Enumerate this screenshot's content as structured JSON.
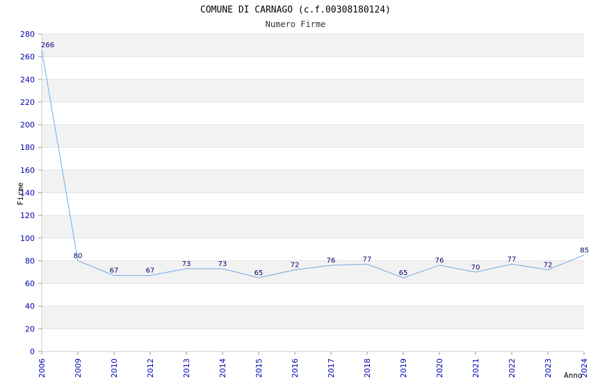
{
  "chart_data": {
    "type": "line",
    "title": "COMUNE DI CARNAGO (c.f.00308180124)",
    "subtitle": "Numero Firme",
    "xlabel": "Anno",
    "ylabel": "Firme",
    "categories": [
      "2006",
      "2009",
      "2010",
      "2012",
      "2013",
      "2014",
      "2015",
      "2016",
      "2017",
      "2018",
      "2019",
      "2020",
      "2021",
      "2022",
      "2023",
      "2024"
    ],
    "values": [
      266,
      80,
      67,
      67,
      73,
      73,
      65,
      72,
      76,
      77,
      65,
      76,
      70,
      77,
      72,
      85
    ],
    "ylim": [
      0,
      280
    ],
    "ytick_step": 20,
    "grid": true,
    "legend": "none",
    "colors": {
      "line": "#6fa8e6",
      "band": "#f2f2f2",
      "tick_text": "#0000aa",
      "data_label": "#000066"
    }
  }
}
